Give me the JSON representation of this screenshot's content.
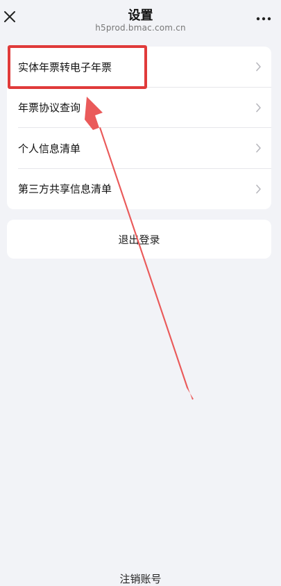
{
  "header": {
    "title": "设置",
    "url": "h5prod.bmac.com.cn",
    "close_icon": "close-icon",
    "more_icon": "more-dots-icon"
  },
  "menu": {
    "items": [
      {
        "label": "实体年票转电子年票"
      },
      {
        "label": "年票协议查询"
      },
      {
        "label": "个人信息清单"
      },
      {
        "label": "第三方共享信息清单"
      }
    ]
  },
  "logout": {
    "label": "退出登录"
  },
  "footer": {
    "cancel_label": "注销账号"
  },
  "annotation": {
    "color": "#e03a3a"
  }
}
